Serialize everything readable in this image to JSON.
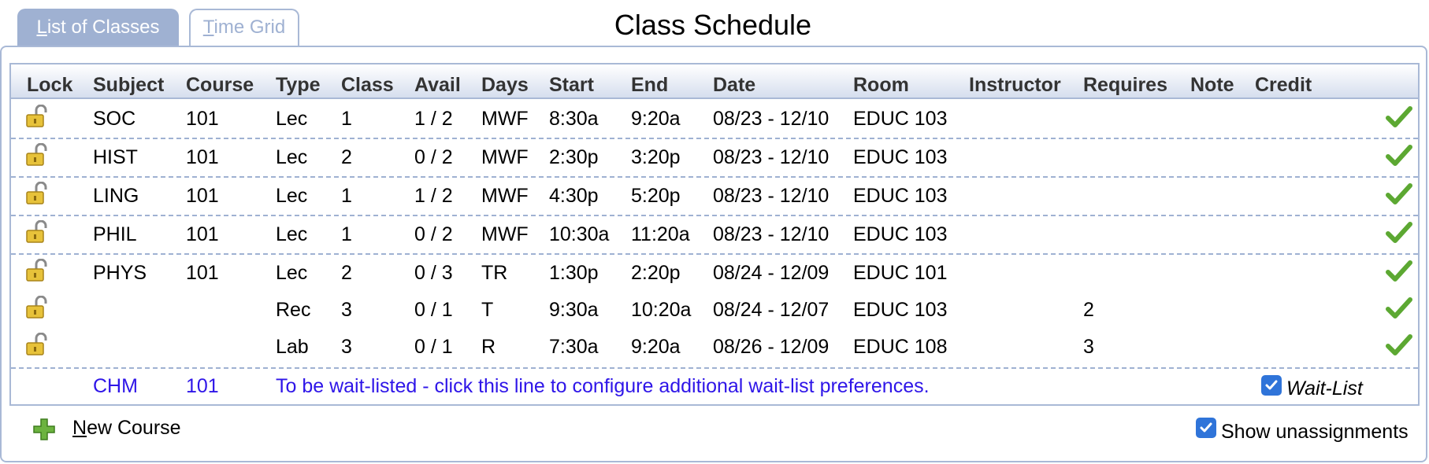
{
  "tabs": {
    "list_prefix": "L",
    "list_rest": "ist of Classes",
    "grid_prefix": "T",
    "grid_rest": "ime Grid"
  },
  "title": "Class Schedule",
  "columns": [
    "Lock",
    "Subject",
    "Course",
    "Type",
    "Class",
    "Avail",
    "Days",
    "Start",
    "End",
    "Date",
    "Room",
    "Instructor",
    "Requires",
    "Note",
    "Credit"
  ],
  "rows": [
    {
      "subject": "SOC",
      "course": "101",
      "type": "Lec",
      "class": "1",
      "avail": "1 / 2",
      "days": "MWF",
      "start": "8:30a",
      "end": "9:20a",
      "date": "08/23 - 12/10",
      "room": "EDUC 103",
      "requires": ""
    },
    {
      "subject": "HIST",
      "course": "101",
      "type": "Lec",
      "class": "2",
      "avail": "0 / 2",
      "days": "MWF",
      "start": "2:30p",
      "end": "3:20p",
      "date": "08/23 - 12/10",
      "room": "EDUC 103",
      "requires": ""
    },
    {
      "subject": "LING",
      "course": "101",
      "type": "Lec",
      "class": "1",
      "avail": "1 / 2",
      "days": "MWF",
      "start": "4:30p",
      "end": "5:20p",
      "date": "08/23 - 12/10",
      "room": "EDUC 103",
      "requires": ""
    },
    {
      "subject": "PHIL",
      "course": "101",
      "type": "Lec",
      "class": "1",
      "avail": "0 / 2",
      "days": "MWF",
      "start": "10:30a",
      "end": "11:20a",
      "date": "08/23 - 12/10",
      "room": "EDUC 103",
      "requires": ""
    },
    {
      "subject": "PHYS",
      "course": "101",
      "type": "Lec",
      "class": "2",
      "avail": "0 / 3",
      "days": "TR",
      "start": "1:30p",
      "end": "2:20p",
      "date": "08/24 - 12/09",
      "room": "EDUC 101",
      "requires": ""
    },
    {
      "subject": "",
      "course": "",
      "type": "Rec",
      "class": "3",
      "avail": "0 / 1",
      "days": "T",
      "start": "9:30a",
      "end": "10:20a",
      "date": "08/24 - 12/07",
      "room": "EDUC 103",
      "requires": "2"
    },
    {
      "subject": "",
      "course": "",
      "type": "Lab",
      "class": "3",
      "avail": "0 / 1",
      "days": "R",
      "start": "7:30a",
      "end": "9:20a",
      "date": "08/26 - 12/09",
      "room": "EDUC 108",
      "requires": "3"
    }
  ],
  "waitlist": {
    "subject": "CHM",
    "course": "101",
    "message": "To be wait-listed - click this line to configure additional wait-list preferences.",
    "checkbox_label": "Wait-List",
    "checked": true
  },
  "footer": {
    "new_prefix": "N",
    "new_rest": "ew Course",
    "show_unassign_label": "Show unassignments",
    "show_checked": true
  },
  "icons": {
    "lock": "unlocked-padlock-icon",
    "check": "checkmark-icon",
    "add": "plus-icon"
  },
  "colors": {
    "accent": "#9fb1d2",
    "link": "#2e15e8",
    "check": "#5ca832"
  }
}
